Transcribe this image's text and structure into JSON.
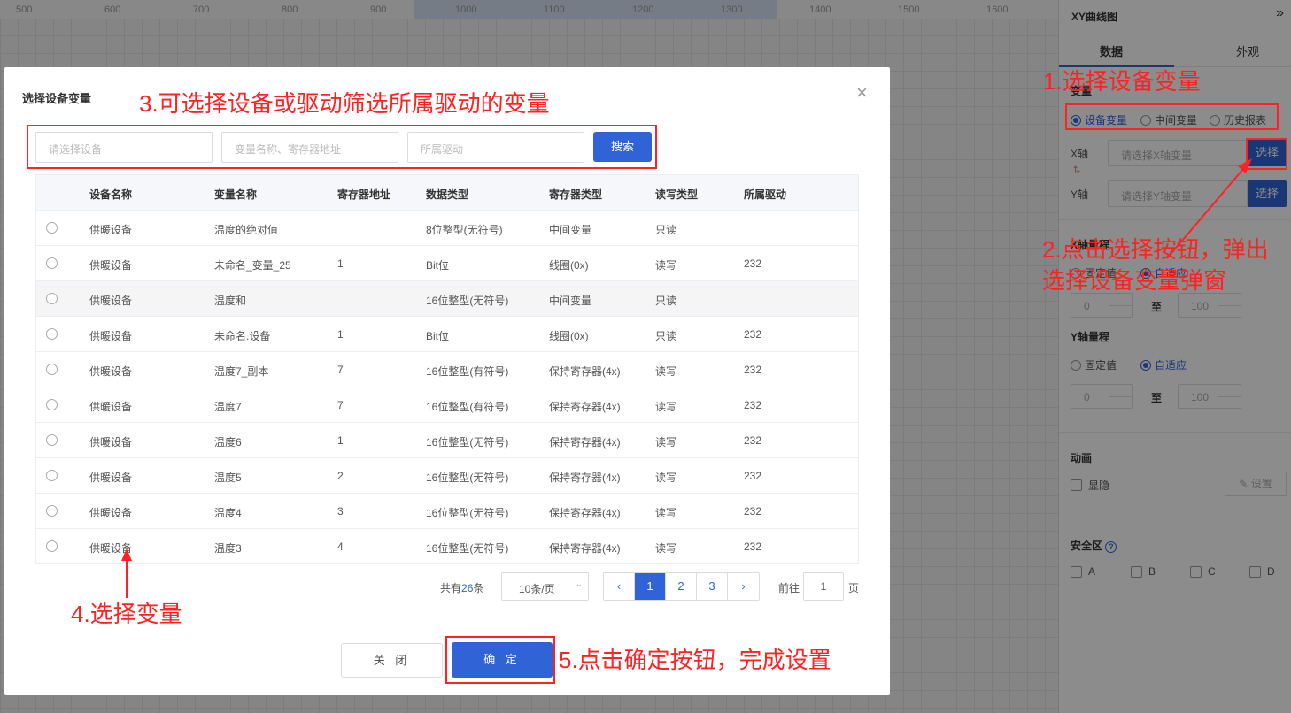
{
  "ruler": {
    "ticks": [
      "500",
      "600",
      "700",
      "800",
      "900",
      "1000",
      "1100",
      "1200",
      "1300",
      "1400",
      "1500",
      "1600"
    ]
  },
  "panel": {
    "title": "XY曲线图",
    "collapse_icon": "double-chevron-right-icon",
    "tabs": [
      "数据",
      "外观"
    ],
    "variable_label": "变量",
    "variable_options": [
      "设备变量",
      "中间变量",
      "历史报表"
    ],
    "x_axis_label": "X轴",
    "x_placeholder": "请选择X轴变量",
    "y_axis_label": "Y轴",
    "y_placeholder": "请选择Y轴变量",
    "select_label": "选择",
    "x_range_label": "X轴量程",
    "y_range_label": "Y轴量程",
    "range_options": [
      "固定值",
      "自适应"
    ],
    "range_min": "0",
    "range_max": "100",
    "range_to": "至",
    "animation_label": "动画",
    "visibility_label": "显隐",
    "settings_label": "设置",
    "safe_zone_label": "安全区",
    "safe_zones": [
      "A",
      "B",
      "C",
      "D"
    ]
  },
  "modal": {
    "title": "选择设备变量",
    "filters": {
      "device_placeholder": "请选择设备",
      "variable_placeholder": "变量名称、寄存器地址",
      "driver_placeholder": "所属驱动",
      "search_label": "搜索"
    },
    "columns": [
      "设备名称",
      "变量名称",
      "寄存器地址",
      "数据类型",
      "寄存器类型",
      "读写类型",
      "所属驱动"
    ],
    "rows": [
      [
        "供暖设备",
        "温度的绝对值",
        "",
        "8位整型(无符号)",
        "中间变量",
        "只读",
        ""
      ],
      [
        "供暖设备",
        "未命名_变量_25",
        "1",
        "Bit位",
        "线圈(0x)",
        "读写",
        "232"
      ],
      [
        "供暖设备",
        "温度和",
        "",
        "16位整型(无符号)",
        "中间变量",
        "只读",
        ""
      ],
      [
        "供暖设备",
        "未命名.设备",
        "1",
        "Bit位",
        "线圈(0x)",
        "只读",
        "232"
      ],
      [
        "供暖设备",
        "温度7_副本",
        "7",
        "16位整型(有符号)",
        "保持寄存器(4x)",
        "读写",
        "232"
      ],
      [
        "供暖设备",
        "温度7",
        "7",
        "16位整型(有符号)",
        "保持寄存器(4x)",
        "读写",
        "232"
      ],
      [
        "供暖设备",
        "温度6",
        "1",
        "16位整型(无符号)",
        "保持寄存器(4x)",
        "读写",
        "232"
      ],
      [
        "供暖设备",
        "温度5",
        "2",
        "16位整型(无符号)",
        "保持寄存器(4x)",
        "读写",
        "232"
      ],
      [
        "供暖设备",
        "温度4",
        "3",
        "16位整型(无符号)",
        "保持寄存器(4x)",
        "读写",
        "232"
      ],
      [
        "供暖设备",
        "温度3",
        "4",
        "16位整型(无符号)",
        "保持寄存器(4x)",
        "读写",
        "232"
      ]
    ],
    "pagination": {
      "total_prefix": "共有",
      "total": "26",
      "total_suffix": "条",
      "page_size": "10条/页",
      "pages": [
        "1",
        "2",
        "3"
      ],
      "current_page": "1",
      "goto_label": "前往",
      "goto_value": "1",
      "page_suffix": "页"
    },
    "close_label": "关 闭",
    "confirm_label": "确 定"
  },
  "annotations": [
    "1.选择设备变量",
    "2.点击选择按钮，弹出",
    "选择设备变量弹窗",
    "3.可选择设备或驱动筛选所属驱动的变量",
    "4.选择变量",
    "5.点击确定按钮，完成设置"
  ],
  "colors": {
    "accent": "#2f63d6",
    "annotation": "#ff2222"
  }
}
